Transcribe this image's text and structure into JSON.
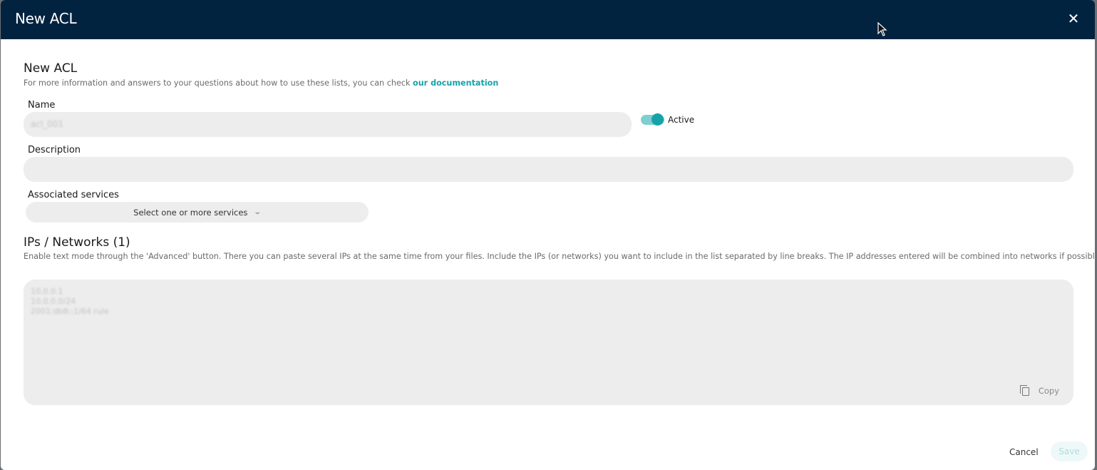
{
  "modal": {
    "header_title": "New ACL",
    "close_glyph": "✕",
    "section": {
      "title": "New ACL",
      "subtitle_prefix": "For more information and answers to your questions about how to use these lists, you can check ",
      "doc_link": "our documentation"
    },
    "name": {
      "label": "Name",
      "value": "acl_001"
    },
    "active_toggle": {
      "label": "Active",
      "on": true
    },
    "description": {
      "label": "Description",
      "value": ""
    },
    "services": {
      "label": "Associated services",
      "placeholder": "Select one or more services"
    },
    "ips": {
      "title": "IPs / Networks (1)",
      "help": "Enable text mode through the 'Advanced' button. There you can paste several IPs at the same time from your files. Include the IPs (or networks) you want to include in the list separated by line breaks. The IP addresses entered will be combined into networks if possible.",
      "lines": [
        "10.0.0.1",
        "10.0.0.0/24",
        "2001:db8::1/64 rule"
      ],
      "copy_label": "Copy"
    },
    "footer": {
      "cancel_label": "Cancel",
      "save_label": "Save"
    }
  },
  "colors": {
    "header_bg": "#012340",
    "accent": "#16a3a8",
    "field_bg": "#ededed"
  },
  "icons": {
    "close": "close-icon",
    "chevron": "chevron-down-icon",
    "copy": "copy-icon",
    "cursor": "mouse-cursor-icon"
  }
}
